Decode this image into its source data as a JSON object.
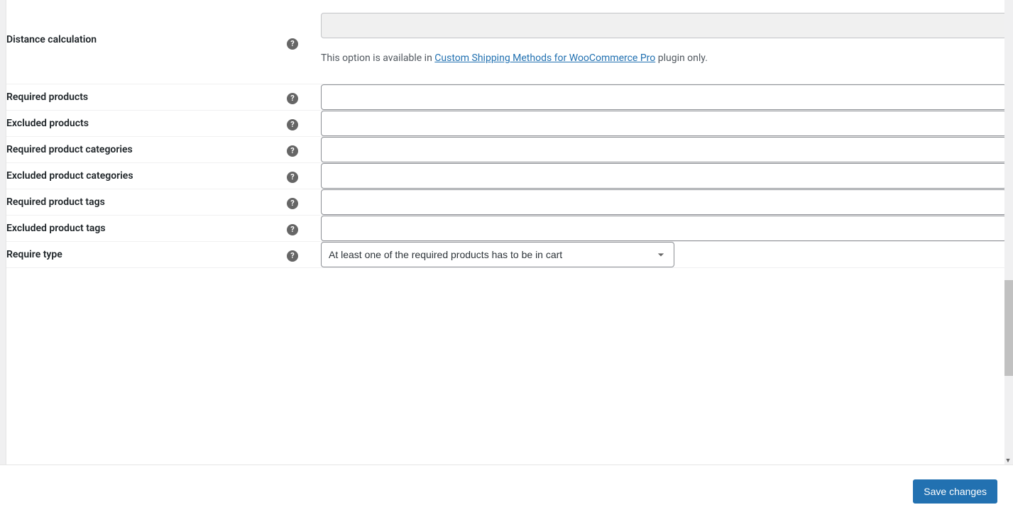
{
  "fields": {
    "distance_calculation": {
      "label": "Distance calculation",
      "helper_prefix": "This option is available in ",
      "helper_link": "Custom Shipping Methods for WooCommerce Pro",
      "helper_suffix": " plugin only.",
      "value": ""
    },
    "required_products": {
      "label": "Required products",
      "value": ""
    },
    "excluded_products": {
      "label": "Excluded products",
      "value": ""
    },
    "required_product_categories": {
      "label": "Required product categories",
      "value": ""
    },
    "excluded_product_categories": {
      "label": "Excluded product categories",
      "value": ""
    },
    "required_product_tags": {
      "label": "Required product tags",
      "value": ""
    },
    "excluded_product_tags": {
      "label": "Excluded product tags",
      "value": ""
    },
    "require_type": {
      "label": "Require type",
      "selected": "At least one of the required products has to be in cart"
    }
  },
  "footer": {
    "save_label": "Save changes"
  }
}
